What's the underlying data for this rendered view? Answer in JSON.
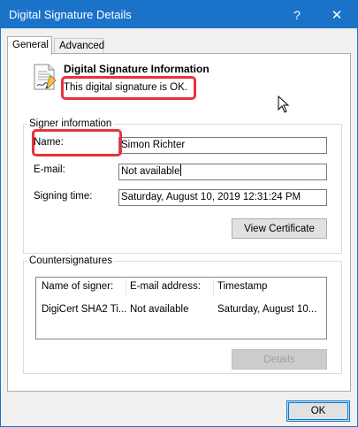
{
  "window": {
    "title": "Digital Signature Details",
    "help_glyph": "?",
    "close_glyph": "✕"
  },
  "tabs": [
    {
      "label": "General",
      "active": true
    },
    {
      "label": "Advanced",
      "active": false
    }
  ],
  "signature": {
    "heading": "Digital Signature Information",
    "status": "This digital signature is OK.",
    "icon": "signature-certificate-icon"
  },
  "signer": {
    "group_label": "Signer information",
    "name_label": "Name:",
    "name_value": "Simon Richter",
    "email_label": "E-mail:",
    "email_value": "Not available",
    "time_label": "Signing time:",
    "time_value": "Saturday, August 10, 2019 12:31:24 PM",
    "view_certificate": "View Certificate"
  },
  "countersignatures": {
    "group_label": "Countersignatures",
    "columns": [
      "Name of signer:",
      "E-mail address:",
      "Timestamp"
    ],
    "rows": [
      [
        "DigiCert SHA2 Ti...",
        "Not available",
        "Saturday, August 10..."
      ]
    ],
    "details_button": "Details"
  },
  "footer": {
    "ok_label": "OK"
  },
  "colors": {
    "titlebar": "#1a73c8",
    "highlight": "#e8323c",
    "focus": "#0078d7"
  }
}
